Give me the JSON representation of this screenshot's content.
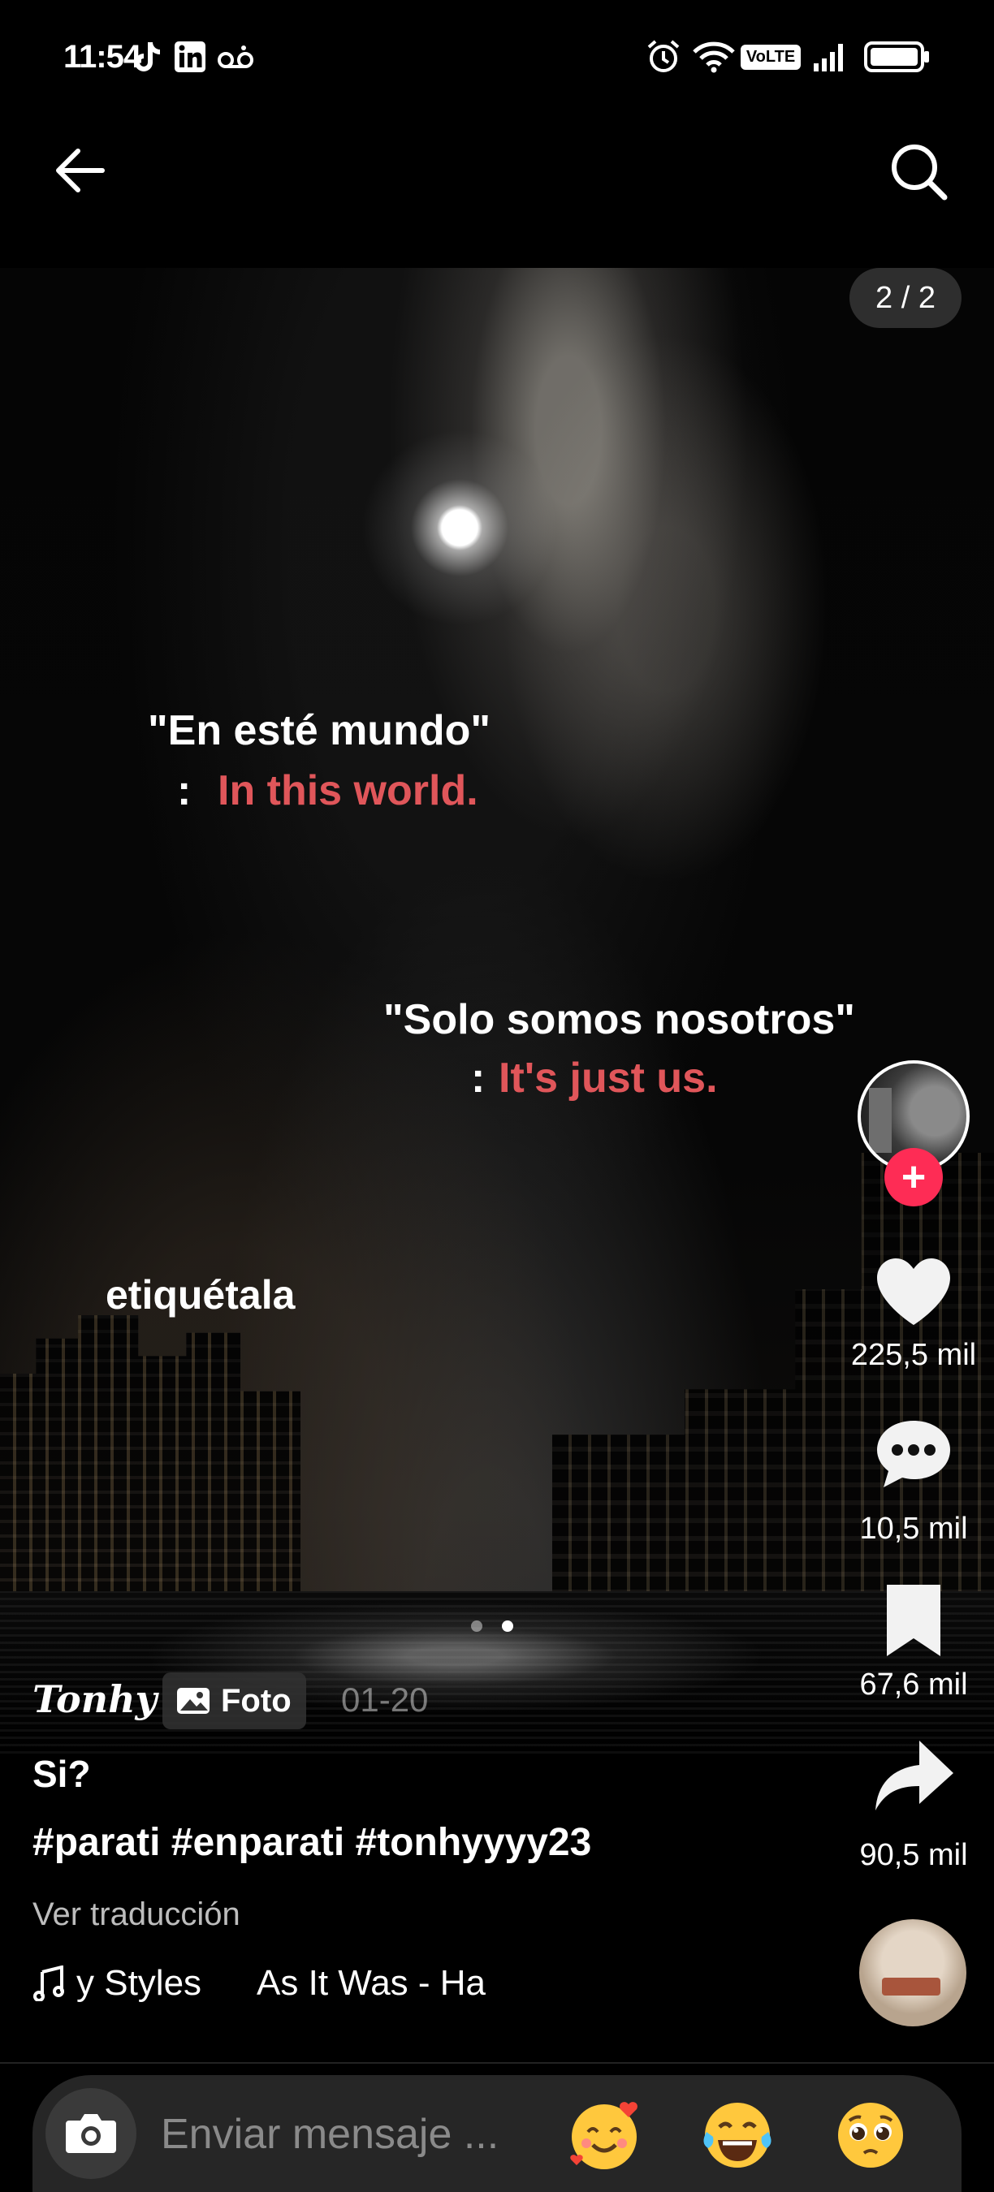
{
  "status_bar": {
    "time": "11:54",
    "icons": [
      "tiktok-icon",
      "linkedin-icon",
      "voicemail-icon",
      "alarm-icon",
      "wifi-icon",
      "volte-icon",
      "signal-icon",
      "battery-icon"
    ],
    "volte_label": "VoLTE"
  },
  "header": {
    "back_icon": "arrow-left-icon",
    "search_icon": "search-icon",
    "photo_counter": "2 / 2"
  },
  "overlay": {
    "line1_es": "\"En esté mundo\"",
    "line1_colon": ":",
    "line1_en": "In this world.",
    "line2_es": "\"Solo somos nosotros\"",
    "line2_colon": ":",
    "line2_en": "It's just us.",
    "tag_label": "etiquétala"
  },
  "actions": {
    "follow_symbol": "+",
    "likes": "225,5 mil",
    "comments": "10,5 mil",
    "saves": "67,6 mil",
    "shares": "90,5 mil"
  },
  "caption": {
    "username": "Tonhy",
    "badge": "Foto",
    "date": "01-20",
    "title": "Si?",
    "hashtags": "#parati #enparati #tonhyyyy23",
    "translate": "Ver traducción",
    "music_a": "y Styles",
    "music_b": "As It Was - Ha"
  },
  "carousel": {
    "total": 2,
    "current": 2
  },
  "message_bar": {
    "placeholder": "Enviar mensaje ...",
    "emojis": [
      "🥰",
      "😂",
      "🥺"
    ]
  },
  "colors": {
    "accent": "#fe2c55",
    "translation_red": "#e0565a"
  }
}
